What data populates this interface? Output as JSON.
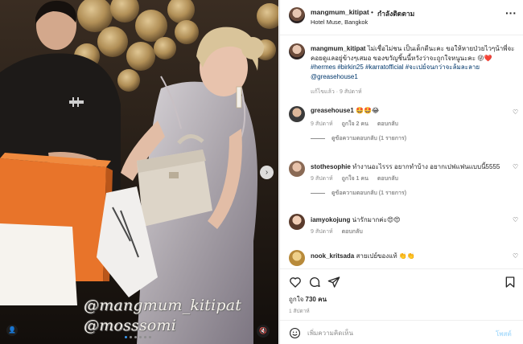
{
  "post": {
    "username": "mangmum_kitipat",
    "follow_separator": "•",
    "follow_label": "กำลังติดตาม",
    "location": "Hotel Muse, Bangkok",
    "caption_text": "ไม่เชื่อไม่ชน เป็นเด็กดีนะคะ ขอให้หายป่วยไวๆน้าพี่จะคอยดูแลอยู่ข้างๆเสมอ ของขวัญชิ้นนี้หวังว่าจะถูกใจหนูนะคะ 😜❤️",
    "caption_tags": "#hermes #birkin25 #karratofficial #จะเปย์จนกว่าจะล้มละลาย @greasehouse1",
    "caption_time": "แก้ไขแล้ว · 9 สัปดาห์",
    "likes_prefix": "ถูกใจ",
    "likes_count": "730 คน",
    "posted_ago": "1 สัปดาห์",
    "add_comment_placeholder": "เพิ่มความคิดเห็น",
    "post_button": "โพสต์"
  },
  "media": {
    "watermark_1": "@mangmum_kitipat",
    "watermark_2": "@mosssomi",
    "carousel_count": 6,
    "carousel_active": 1,
    "colors": {
      "box_orange": "#e8742a",
      "bag_beige": "#ddd5c8",
      "balloon_gold": "#b8955a",
      "dress_silver": "#b9b4b8"
    }
  },
  "comments": [
    {
      "username": "greasehouse1",
      "text": "🤩🤩😂",
      "time": "9 สัปดาห์",
      "likes": "ถูกใจ 2 คน",
      "reply": "ตอบกลับ",
      "view_replies": "ดูข้อความตอบกลับ (1 รายการ)"
    },
    {
      "username": "stothesophie",
      "text": "ทำงานอะไรรร อยากทำบ้าง อยากเปฟแฟนแบบนี้5555",
      "time": "9 สัปดาห์",
      "likes": "ถูกใจ 1 คน",
      "reply": "ตอบกลับ",
      "view_replies": "ดูข้อความตอบกลับ (1 รายการ)"
    },
    {
      "username": "iamyokojung",
      "text": "น่ารักมากค่ะ😍😍",
      "time": "9 สัปดาห์",
      "likes": "",
      "reply": "ตอบกลับ",
      "view_replies": ""
    },
    {
      "username": "nook_kritsada",
      "text": "สายเปย์ของแท้ 👏👏",
      "time": "",
      "likes": "",
      "reply": "",
      "view_replies": ""
    }
  ],
  "icons": {
    "more": "more-horizontal-icon",
    "like": "heart-icon",
    "comment": "comment-bubble-icon",
    "share": "paper-plane-icon",
    "save": "bookmark-icon",
    "emoji": "smiley-icon",
    "next": "chevron-right-icon",
    "tag": "user-tag-icon",
    "mute": "speaker-muted-icon"
  }
}
